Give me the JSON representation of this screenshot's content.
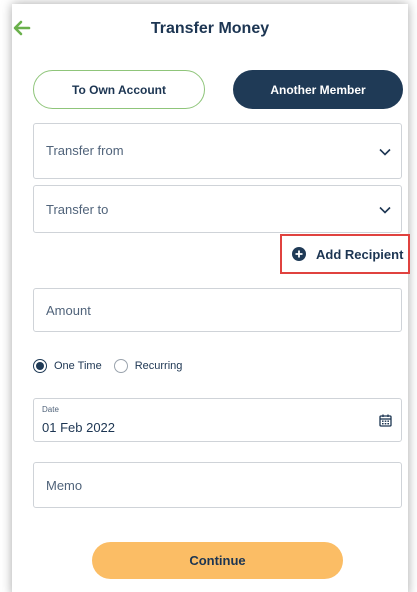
{
  "header": {
    "title": "Transfer Money",
    "back_icon": "arrow-left-icon"
  },
  "segment": {
    "own_label": "To Own Account",
    "other_label": "Another Member",
    "selected": "Another Member"
  },
  "form": {
    "transfer_from": "Transfer from",
    "transfer_to": "Transfer to",
    "add_recipient": "Add Recipient",
    "amount": "Amount",
    "frequency": {
      "options": [
        "One Time",
        "Recurring"
      ],
      "selected": "One Time"
    },
    "date": {
      "label": "Date",
      "value": "01 Feb 2022"
    },
    "memo": "Memo"
  },
  "actions": {
    "continue": "Continue"
  },
  "colors": {
    "primary_dark": "#1f3a56",
    "accent_green": "#6ab04c",
    "highlight_red": "#e0423f",
    "button_orange": "#fbbd65"
  }
}
